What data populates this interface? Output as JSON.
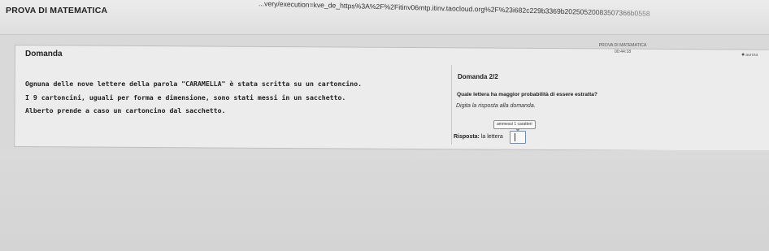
{
  "app": {
    "title": "PROVA DI MATEMATICA"
  },
  "browser": {
    "url": "...very/execution=kve_de_https%3A%2F%2Fitinv06mtp.itinv.taocloud.org%2F%23i682c229b3369b20250520083507366b0558"
  },
  "header": {
    "test_name": "PROVA DI MATEMATICA",
    "timer": "00:44:18",
    "user_icon": "user-icon",
    "user_label": "aurora"
  },
  "section": {
    "title": "Domanda"
  },
  "prompt": {
    "lines": [
      "Ognuna delle nove lettere della parola \"CARAMELLA\" è stata scritta su un cartoncino.",
      "I 9 cartoncini, uguali per forma e dimensione, sono stati messi in un sacchetto.",
      "Alberto prende a caso un cartoncino dal sacchetto."
    ]
  },
  "question": {
    "number": "Domanda 2/2",
    "text": "Quale lettera ha maggior probabilità di essere estratta?",
    "instruction": "Digita la risposta alla domanda.",
    "tooltip": "ammessi 1 caratteri",
    "answer_label_bold": "Risposta:",
    "answer_label_rest": "la lettera",
    "answer_value": ""
  }
}
